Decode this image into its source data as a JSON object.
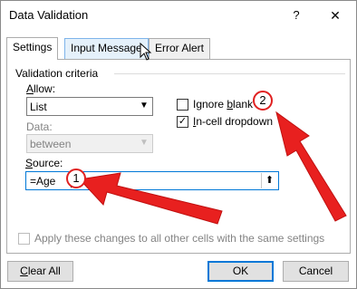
{
  "window": {
    "title": "Data Validation",
    "help_glyph": "?",
    "close_glyph": "✕"
  },
  "tabs": [
    {
      "label": "Settings",
      "active": true
    },
    {
      "label": "Input Message",
      "active": false
    },
    {
      "label": "Error Alert",
      "active": false
    }
  ],
  "settings": {
    "section_title": "Validation criteria",
    "allow": {
      "label_underline": "A",
      "label_rest": "llow:",
      "value": "List"
    },
    "data": {
      "label": "Data:",
      "value": "between"
    },
    "ignore_blank": {
      "label_prefix": "Ignore ",
      "label_underline": "b",
      "label_rest": "lank",
      "checked": false
    },
    "in_cell_dropdown": {
      "label_underline": "I",
      "label_rest": "n-cell dropdown",
      "checked": true
    },
    "source": {
      "label_underline": "S",
      "label_rest": "ource:",
      "value": "=Age"
    },
    "apply_all": {
      "label": "Apply these changes to all other cells with the same settings",
      "checked": false
    }
  },
  "buttons": {
    "clear_all": {
      "underline": "C",
      "rest": "lear All"
    },
    "ok": "OK",
    "cancel": "Cancel"
  },
  "annotations": {
    "badge1": "1",
    "badge2": "2",
    "arrow_color": "#e8201f"
  }
}
